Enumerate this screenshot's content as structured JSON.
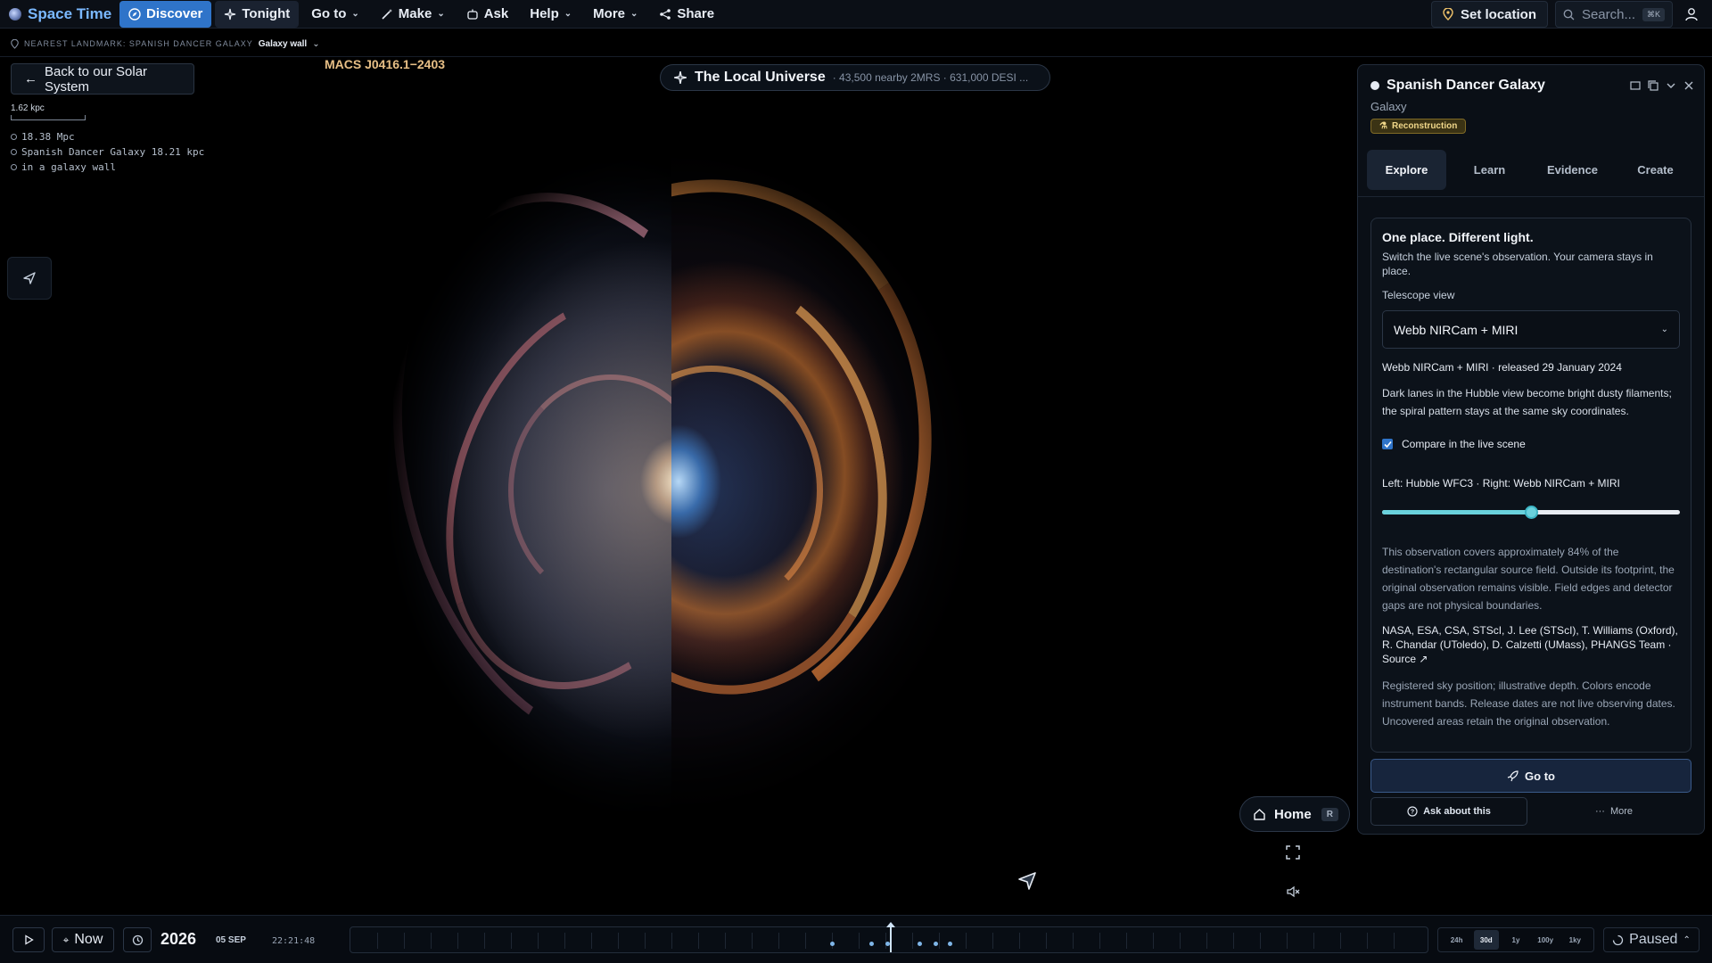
{
  "app": {
    "name": "Space Time"
  },
  "nav": {
    "discover": "Discover",
    "tonight": "Tonight",
    "goto": "Go to",
    "make": "Make",
    "ask": "Ask",
    "help": "Help",
    "more": "More",
    "share": "Share"
  },
  "topright": {
    "set_location": "Set location",
    "search_placeholder": "Search...",
    "search_shortcut": "⌘K"
  },
  "landmark": {
    "label": "NEAREST LANDMARK: SPANISH DANCER GALAXY",
    "value": "Galaxy wall"
  },
  "back_button": "Back to our Solar System",
  "field_label": "MACS J0416.1−2403",
  "scale": {
    "label": "1.62 kpc"
  },
  "info": {
    "line1": "18.38 Mpc",
    "line2": "Spanish Dancer Galaxy 18.21 kpc",
    "line3": "in a galaxy wall"
  },
  "universe": {
    "title": "The Local Universe",
    "subtitle": "· 43,500 nearby 2MRS · 631,000 DESI ..."
  },
  "panel": {
    "title": "Spanish Dancer Galaxy",
    "type": "Galaxy",
    "badge": "Reconstruction",
    "tabs": [
      "Explore",
      "Learn",
      "Evidence",
      "Create"
    ],
    "active_tab": "Explore",
    "card": {
      "heading": "One place. Different light.",
      "lead": "Switch the live scene's observation. Your camera stays in place.",
      "telescope_label": "Telescope view",
      "telescope_value": "Webb NIRCam + MIRI",
      "release": "Webb NIRCam + MIRI · released 29 January 2024",
      "description": "Dark lanes in the Hubble view become bright dusty filaments; the spiral pattern stays at the same sky coordinates.",
      "compare_label": "Compare in the live scene",
      "compare_checked": true,
      "split_label": "Left: Hubble WFC3 · Right: Webb NIRCam + MIRI",
      "split_fraction": 0.5,
      "coverage": "This observation covers approximately 84% of the destination's rectangular source field. Outside its footprint, the original observation remains visible. Field edges and detector gaps are not physical boundaries.",
      "credits": "NASA, ESA, CSA, STScI, J. Lee (STScI), T. Williams (Oxford), R. Chandar (UToledo), D. Calzetti (UMass), PHANGS Team ·",
      "source_link": "Source ↗",
      "notes": "Registered sky position; illustrative depth. Colors encode instrument bands. Release dates are not live observing dates. Uncovered areas retain the original observation."
    },
    "goto_button": "Go to",
    "ask_button": "Ask about this",
    "more_button": "More"
  },
  "home": {
    "label": "Home",
    "shortcut": "R"
  },
  "timebar": {
    "now": "Now",
    "year": "2026",
    "date": "05 SEP",
    "time": "22:21:48",
    "ranges": [
      "24h",
      "30d",
      "1y",
      "100y",
      "1ky"
    ],
    "active_range": "30d",
    "status": "Paused"
  },
  "colors": {
    "accent": "#2f74c9",
    "brand": "#7ab8ff",
    "badge": "#f0d78a",
    "slider": "#6ad1dc"
  }
}
